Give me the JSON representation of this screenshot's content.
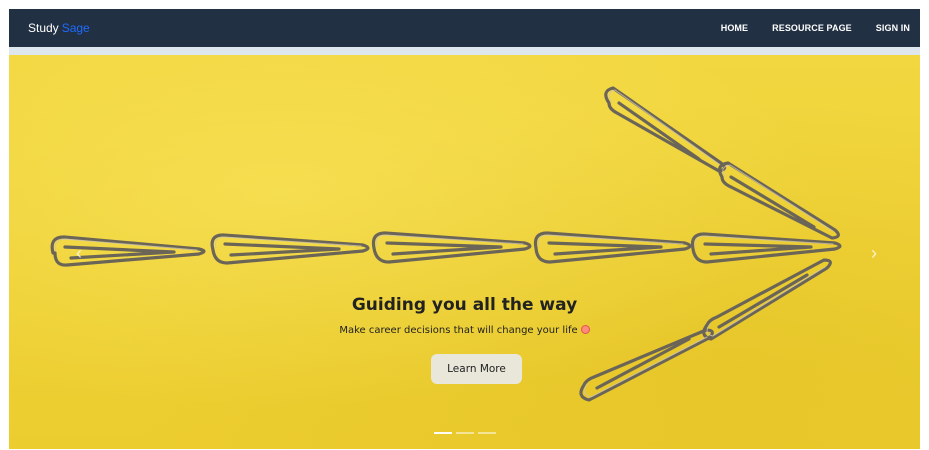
{
  "navbar": {
    "brand_primary": "Study",
    "brand_accent": "Sage",
    "links": [
      "HOME",
      "RESOURCE PAGE",
      "SIGN IN"
    ],
    "background": "#223043",
    "accent_color": "#1e6bff"
  },
  "carousel": {
    "title": "Guiding you all the way",
    "text": "Make career decisions that will change your life",
    "button_label": "Learn More",
    "prev_icon": "chevron-left-icon",
    "next_icon": "chevron-right-icon",
    "prev_glyph": "‹",
    "next_glyph": "›",
    "slide_count": 3,
    "active_slide": 1,
    "background_color": "#efd23a",
    "emoji": "smiling-face-with-hearts-icon"
  }
}
